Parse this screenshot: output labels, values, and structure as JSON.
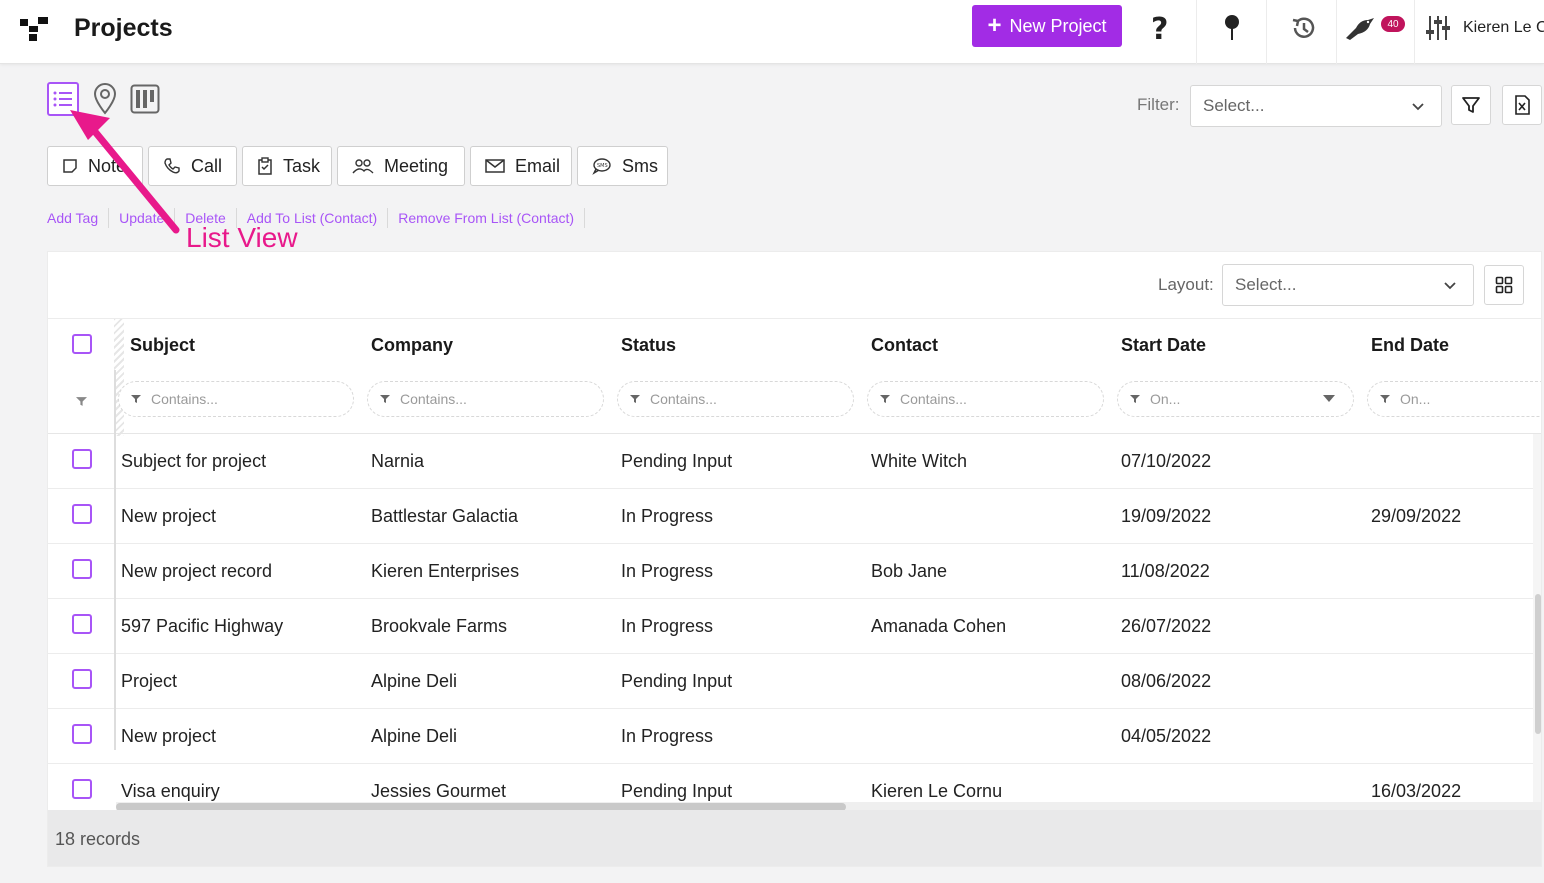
{
  "app": {
    "page_title": "Projects",
    "new_project_label": "New Project",
    "notification_count": "40",
    "user_name": "Kieren Le C",
    "accent_color": "#a22ce5",
    "badge_color": "#c0145c"
  },
  "header_icons": [
    "help-icon",
    "pin-icon",
    "history-icon",
    "bird-icon",
    "settings-sliders-icon"
  ],
  "toolbar": {
    "filter_label": "Filter:",
    "filter_placeholder": "Select...",
    "layout_label": "Layout:",
    "layout_placeholder": "Select..."
  },
  "view_toggles": [
    "list-view-icon",
    "map-view-icon",
    "board-view-icon"
  ],
  "activity_buttons": [
    {
      "label": "Note",
      "icon": "note-icon"
    },
    {
      "label": "Call",
      "icon": "phone-icon"
    },
    {
      "label": "Task",
      "icon": "task-icon"
    },
    {
      "label": "Meeting",
      "icon": "meeting-icon"
    },
    {
      "label": "Email",
      "icon": "email-icon"
    },
    {
      "label": "Sms",
      "icon": "sms-icon"
    }
  ],
  "action_links": [
    "Add Tag",
    "Update",
    "Delete",
    "Add To List (Contact)",
    "Remove From List (Contact)"
  ],
  "grid": {
    "columns": [
      "Subject",
      "Company",
      "Status",
      "Contact",
      "Start Date",
      "End Date"
    ],
    "filter_placeholders": [
      "Contains...",
      "Contains...",
      "Contains...",
      "Contains...",
      "On...",
      "On..."
    ],
    "rows": [
      [
        "Subject for project",
        "Narnia",
        "Pending Input",
        "White Witch",
        "07/10/2022",
        ""
      ],
      [
        "New project",
        "Battlestar Galactia",
        "In Progress",
        "",
        "19/09/2022",
        "29/09/2022"
      ],
      [
        "New project record",
        "Kieren Enterprises",
        "In Progress",
        "Bob Jane",
        "11/08/2022",
        ""
      ],
      [
        "597 Pacific Highway",
        "Brookvale Farms",
        "In Progress",
        "Amanada Cohen",
        "26/07/2022",
        ""
      ],
      [
        "Project",
        "Alpine Deli",
        "Pending Input",
        "",
        "08/06/2022",
        ""
      ],
      [
        "New project",
        "Alpine Deli",
        "In Progress",
        "",
        "04/05/2022",
        ""
      ],
      [
        "Visa enquiry",
        "Jessies Gourmet",
        "Pending Input",
        "Kieren Le Cornu",
        "",
        "16/03/2022"
      ]
    ],
    "record_count": "18 records"
  },
  "annotation": {
    "label": "List View",
    "color": "#e8198b"
  }
}
